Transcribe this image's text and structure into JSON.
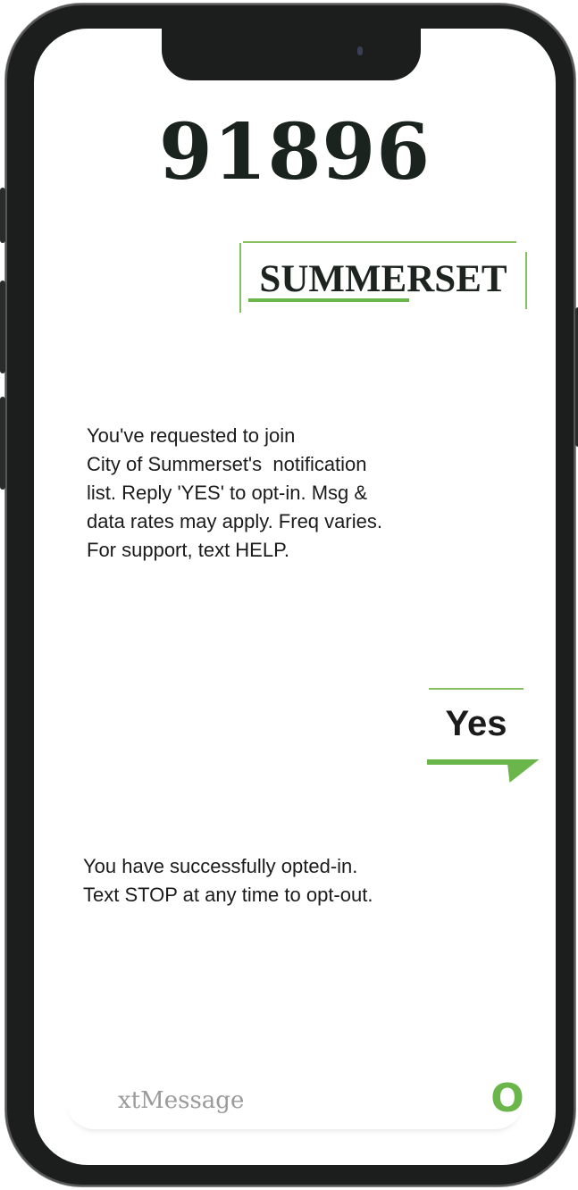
{
  "header": {
    "number": "91896"
  },
  "brand": {
    "name": "SUMMERSET"
  },
  "messages": {
    "incoming_1": [
      "You've requested to join",
      "City of Summerset's  notification",
      "list. Reply 'YES' to opt-in. Msg &",
      "data rates may apply. Freq varies.",
      "For support, text HELP."
    ],
    "outgoing_1": "Yes",
    "incoming_2": [
      "You have successfully opted-in.",
      "Text STOP at any time to opt-out."
    ]
  },
  "compose": {
    "placeholder": "xtMessage",
    "send_icon": "send-icon",
    "send_glyph": "O"
  },
  "colors": {
    "accent": "#6bb64a",
    "accent_light": "#86c061",
    "frame": "#1c1e1d",
    "text": "#1b1b1b"
  }
}
